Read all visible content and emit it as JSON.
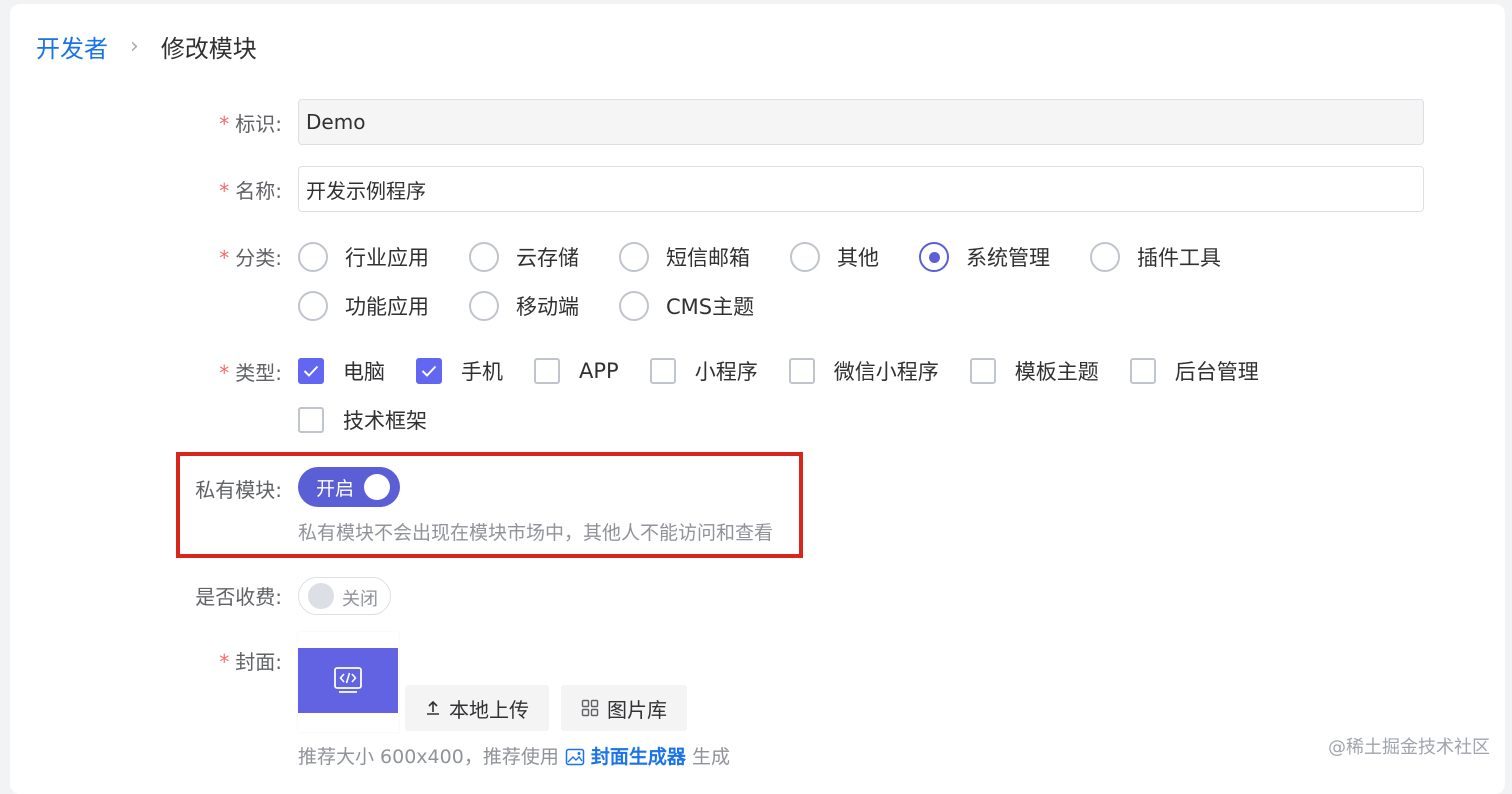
{
  "breadcrumb": {
    "parent": "开发者",
    "separator": "›",
    "current": "修改模块"
  },
  "form": {
    "required_mark": "*",
    "identifier": {
      "label": "标识:",
      "value": "Demo"
    },
    "name": {
      "label": "名称:",
      "value": "开发示例程序"
    },
    "category": {
      "label": "分类:",
      "options": [
        "行业应用",
        "云存储",
        "短信邮箱",
        "其他",
        "系统管理",
        "插件工具",
        "功能应用",
        "移动端",
        "CMS主题"
      ],
      "selected": "系统管理"
    },
    "type": {
      "label": "类型:",
      "options": [
        "电脑",
        "手机",
        "APP",
        "小程序",
        "微信小程序",
        "模板主题",
        "后台管理",
        "技术框架"
      ],
      "checked": [
        "电脑",
        "手机"
      ]
    },
    "private_module": {
      "label": "私有模块:",
      "switch_text": "开启",
      "state": "on",
      "hint": "私有模块不会出现在模块市场中，其他人不能访问和查看"
    },
    "paid": {
      "label": "是否收费:",
      "switch_text": "关闭",
      "state": "off"
    },
    "cover": {
      "label": "封面:",
      "upload_button": "本地上传",
      "gallery_button": "图片库",
      "hint_prefix": "推荐大小 600x400，推荐使用",
      "generator_link": "封面生成器",
      "hint_suffix": "生成",
      "cover_color": "#6163e3"
    }
  },
  "colors": {
    "primary": "#5b5fd6",
    "link": "#1a73e8",
    "required": "#f56c6c",
    "highlight": "#d9261c"
  },
  "watermark": "@稀土掘金技术社区"
}
